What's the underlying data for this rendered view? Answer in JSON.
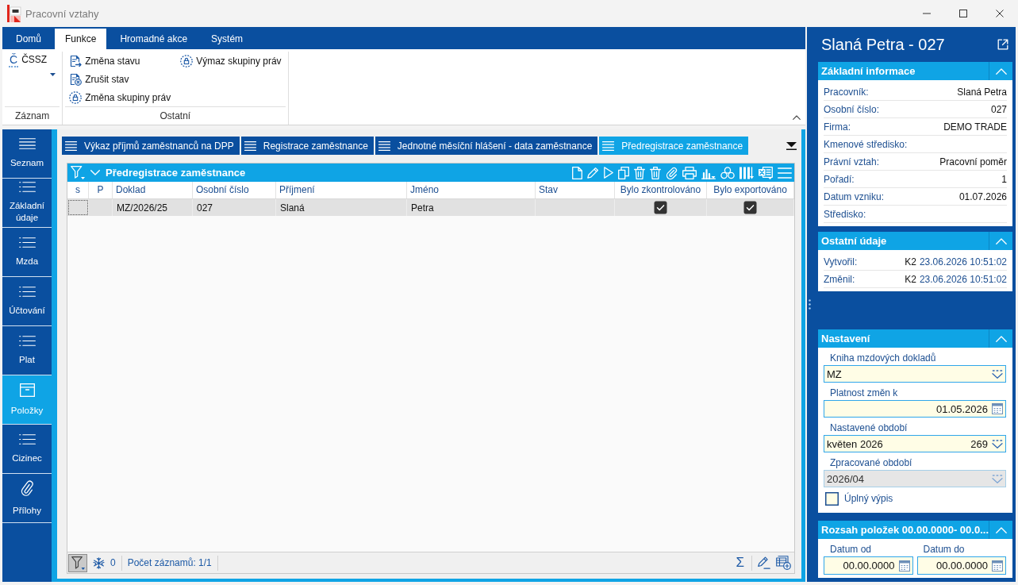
{
  "window": {
    "title": "Pracovní vztahy"
  },
  "ribbon": {
    "tabs": [
      {
        "label": "Domů",
        "selected": false
      },
      {
        "label": "Funkce",
        "selected": true
      },
      {
        "label": "Hromadné akce",
        "selected": false
      },
      {
        "label": "Systém",
        "selected": false
      }
    ],
    "groups": [
      {
        "label": "Záznam",
        "items": [
          {
            "kind": "dropdown",
            "icon_text": "Č",
            "label": "ČSSZ"
          }
        ]
      },
      {
        "label": "Ostatní",
        "items": [
          {
            "kind": "status",
            "label": "Změna stavu"
          },
          {
            "kind": "cancel",
            "label": "Zrušit stav"
          },
          {
            "kind": "rights",
            "label": "Změna skupiny práv"
          },
          {
            "kind": "rights",
            "label": "Výmaz skupiny práv"
          }
        ]
      }
    ]
  },
  "sidebar": {
    "items": [
      {
        "kind": "list",
        "label": "Seznam",
        "selected": false
      },
      {
        "kind": "section",
        "label": "Základní údaje",
        "selected": false
      },
      {
        "kind": "section",
        "label": "Mzda",
        "selected": false
      },
      {
        "kind": "section",
        "label": "Účtování",
        "selected": false
      },
      {
        "kind": "section",
        "label": "Plat",
        "selected": false
      },
      {
        "kind": "items",
        "label": "Položky",
        "selected": true
      },
      {
        "kind": "section",
        "label": "Cizinec",
        "selected": false
      },
      {
        "kind": "attachments",
        "label": "Přílohy",
        "selected": false
      }
    ]
  },
  "doc_tabs": [
    {
      "label": "Výkaz příjmů zaměstnanců na DPP",
      "selected": false
    },
    {
      "label": "Registrace zaměstnance",
      "selected": false
    },
    {
      "label": "Jednotné měsíční hlášení - data zaměstnance",
      "selected": false
    },
    {
      "label": "Předregistrace zaměstnance",
      "selected": true
    }
  ],
  "grid": {
    "title": "Předregistrace zaměstnance",
    "columns": [
      {
        "label": "s",
        "kind": "flag"
      },
      {
        "label": "P",
        "kind": "flag"
      },
      {
        "label": "Doklad",
        "kind": "text"
      },
      {
        "label": "Osobní číslo",
        "kind": "text"
      },
      {
        "label": "Příjmení",
        "kind": "text"
      },
      {
        "label": "Jméno",
        "kind": "text"
      },
      {
        "label": "Stav",
        "kind": "text"
      },
      {
        "label": "Bylo zkontrolováno",
        "kind": "check"
      },
      {
        "label": "Bylo exportováno",
        "kind": "check"
      }
    ],
    "rows": [
      {
        "selected": true,
        "cells": [
          null,
          null,
          "MZ/2026/25",
          "027",
          "Slaná",
          "Petra",
          null,
          true,
          true
        ]
      }
    ]
  },
  "status_bar": {
    "filter_on": true,
    "frozen_count": "0",
    "record_count": "Počet záznamů: 1/1",
    "sum": "Σ"
  },
  "detail": {
    "title": "Slaná Petra - 027",
    "sections": [
      {
        "kind": "info",
        "title": "Základní informace",
        "expanded": true,
        "rows": [
          {
            "label": "Pracovník:",
            "value": "Slaná Petra"
          },
          {
            "label": "Osobní číslo:",
            "value": "027"
          },
          {
            "label": "Firma:",
            "value": "DEMO TRADE"
          },
          {
            "label": "Kmenové středisko:"
          },
          {
            "label": "Právní vztah:",
            "value": "Pracovní poměr"
          },
          {
            "label": "Pořadí:",
            "value": "1"
          },
          {
            "label": "Datum vzniku:",
            "value": "01.07.2026"
          },
          {
            "label": "Středisko:"
          }
        ]
      },
      {
        "kind": "audit",
        "title": "Ostatní údaje",
        "expanded": true,
        "rows": [
          {
            "label": "Vytvořil:",
            "user": "K2",
            "time": "23.06.2026 10:51:02"
          },
          {
            "label": "Změnil:",
            "user": "K2",
            "time": "23.06.2026 10:51:02"
          }
        ]
      },
      {
        "kind": "form",
        "title": "Nastavení",
        "expanded": true,
        "fields": [
          {
            "kind": "dropdown",
            "label": "Kniha mzdových dokladů",
            "value": "MZ",
            "disabled": false
          },
          {
            "kind": "date",
            "label": "Platnost změn k",
            "value": "01.05.2026",
            "disabled": false
          },
          {
            "kind": "dropdown",
            "label": "Nastavené období",
            "value": "květen 2026",
            "secondary_value": "269",
            "disabled": false
          },
          {
            "kind": "dropdown",
            "label": "Zpracované období",
            "value": "2026/04",
            "disabled": true
          },
          {
            "kind": "checkbox",
            "label": "Úplný výpis",
            "checked": false,
            "disabled": false
          }
        ]
      },
      {
        "kind": "range",
        "title": "Rozsah položek 00.00.0000- 00.0...",
        "expanded": true,
        "fields": [
          {
            "kind": "date",
            "label": "Datum od",
            "value": "00.00.0000",
            "disabled": false
          },
          {
            "kind": "date",
            "label": "Datum do",
            "value": "00.00.0000",
            "disabled": false
          }
        ]
      }
    ]
  }
}
